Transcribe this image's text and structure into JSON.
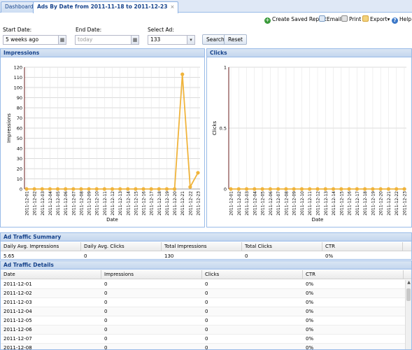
{
  "tabs": [
    {
      "label": "Dashboard",
      "active": false
    },
    {
      "label": "Ads By Date from 2011-11-18 to 2011-12-23",
      "active": true,
      "close": "×"
    }
  ],
  "toolbar": {
    "items": [
      {
        "label": "Create Saved Report",
        "icon": "plus-icon",
        "color": "#3a9a3a"
      },
      {
        "label": "Email",
        "icon": "email-icon",
        "color": "#7a9cc4"
      },
      {
        "label": "Print",
        "icon": "printer-icon",
        "color": "#8a8a8a"
      },
      {
        "label": "Export",
        "icon": "export-icon",
        "color": "#d6a43a",
        "caret": "▾"
      },
      {
        "label": "Help",
        "icon": "help-icon",
        "color": "#3c78c8"
      }
    ]
  },
  "filters": {
    "start_label": "Start Date:",
    "start_value": "5 weeks ago",
    "end_label": "End Date:",
    "end_placeholder": "today",
    "ad_label": "Select Ad:",
    "ad_value": "133",
    "search_label": "Search",
    "reset_label": "Reset"
  },
  "impressions_panel": {
    "title": "Impressions"
  },
  "clicks_panel": {
    "title": "Clicks"
  },
  "chart_data": [
    {
      "type": "line",
      "title": "Impressions",
      "xlabel": "Date",
      "ylabel": "Impressions",
      "ylim": [
        0,
        120
      ],
      "yticks": [
        0,
        10,
        20,
        30,
        40,
        50,
        60,
        70,
        80,
        90,
        100,
        110,
        120
      ],
      "x": [
        "2011-12-01",
        "2011-12-02",
        "2011-12-03",
        "2011-12-04",
        "2011-12-05",
        "2011-12-06",
        "2011-12-07",
        "2011-12-08",
        "2011-12-09",
        "2011-12-10",
        "2011-12-11",
        "2011-12-12",
        "2011-12-13",
        "2011-12-14",
        "2011-12-15",
        "2011-12-16",
        "2011-12-17",
        "2011-12-18",
        "2011-12-19",
        "2011-12-20",
        "2011-12-21",
        "2011-12-22",
        "2011-12-23"
      ],
      "series": [
        {
          "values": [
            0,
            0,
            0,
            0,
            0,
            0,
            0,
            0,
            0,
            0,
            0,
            0,
            0,
            0,
            0,
            0,
            0,
            0,
            0,
            0,
            113,
            2,
            16
          ],
          "color": "#f0b43c"
        }
      ],
      "grid": true
    },
    {
      "type": "line",
      "title": "Clicks",
      "xlabel": "Date",
      "ylabel": "Clicks",
      "ylim": [
        0,
        1
      ],
      "yticks": [
        "0",
        "0.5",
        "1"
      ],
      "x": [
        "2011-12-01",
        "2011-12-02",
        "2011-12-03",
        "2011-12-04",
        "2011-12-05",
        "2011-12-06",
        "2011-12-07",
        "2011-12-08",
        "2011-12-09",
        "2011-12-10",
        "2011-12-11",
        "2011-12-12",
        "2011-12-13",
        "2011-12-14",
        "2011-12-15",
        "2011-12-16",
        "2011-12-17",
        "2011-12-18",
        "2011-12-19",
        "2011-12-20",
        "2011-12-21",
        "2011-12-22",
        "2011-12-23"
      ],
      "series": [
        {
          "values": [
            0,
            0,
            0,
            0,
            0,
            0,
            0,
            0,
            0,
            0,
            0,
            0,
            0,
            0,
            0,
            0,
            0,
            0,
            0,
            0,
            0,
            0,
            0
          ],
          "color": "#f0b43c"
        }
      ],
      "grid": true
    }
  ],
  "summary": {
    "title": "Ad Traffic Summary",
    "columns": [
      "Daily Avg. Impressions",
      "Daily Avg. Clicks",
      "Total Impressions",
      "Total Clicks",
      "CTR"
    ],
    "row": [
      "5.65",
      "0",
      "130",
      "0",
      "0%"
    ]
  },
  "details": {
    "title": "Ad Traffic Details",
    "columns": [
      "Date",
      "Impressions",
      "Clicks",
      "CTR"
    ],
    "rows": [
      [
        "2011-12-01",
        "0",
        "0",
        "0%"
      ],
      [
        "2011-12-02",
        "0",
        "0",
        "0%"
      ],
      [
        "2011-12-03",
        "0",
        "0",
        "0%"
      ],
      [
        "2011-12-04",
        "0",
        "0",
        "0%"
      ],
      [
        "2011-12-05",
        "0",
        "0",
        "0%"
      ],
      [
        "2011-12-06",
        "0",
        "0",
        "0%"
      ],
      [
        "2011-12-07",
        "0",
        "0",
        "0%"
      ],
      [
        "2011-12-08",
        "0",
        "0",
        "0%"
      ]
    ]
  }
}
